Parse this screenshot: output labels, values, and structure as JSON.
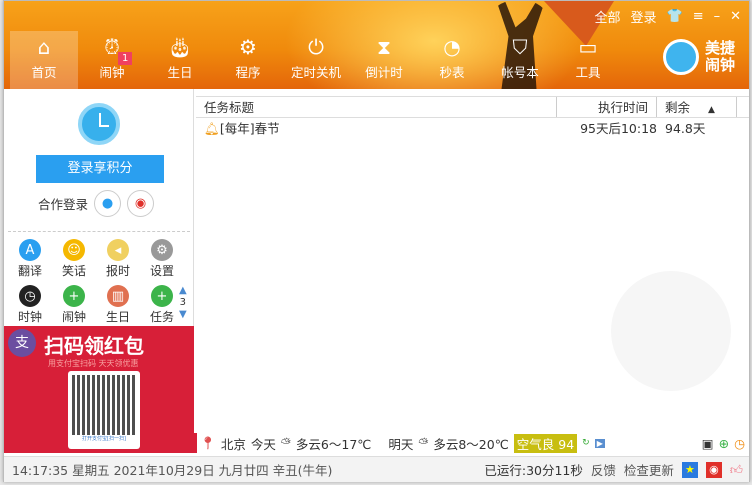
{
  "header": {
    "top_links": [
      "全部",
      "登录"
    ],
    "nav": [
      {
        "label": "首页",
        "icon": "home-icon"
      },
      {
        "label": "闹钟",
        "icon": "alarm-icon",
        "badge": "1"
      },
      {
        "label": "生日",
        "icon": "cake-icon"
      },
      {
        "label": "程序",
        "icon": "gear-icon"
      },
      {
        "label": "定时关机",
        "icon": "power-icon"
      },
      {
        "label": "倒计时",
        "icon": "hourglass-icon"
      },
      {
        "label": "秒表",
        "icon": "stopwatch-icon"
      },
      {
        "label": "帐号本",
        "icon": "shield-icon"
      },
      {
        "label": "工具",
        "icon": "monitor-icon"
      }
    ],
    "brand": "美捷闹钟"
  },
  "left": {
    "login_button": "登录享积分",
    "coop_login": "合作登录",
    "tools": [
      {
        "label": "翻译",
        "color": "#2a9ff0",
        "glyph": "A"
      },
      {
        "label": "笑话",
        "color": "#f5b800",
        "glyph": "☺"
      },
      {
        "label": "报时",
        "color": "#f0d060",
        "glyph": "◂"
      },
      {
        "label": "设置",
        "color": "#999999",
        "glyph": "⚙"
      },
      {
        "label": "时钟",
        "color": "#222222",
        "glyph": "◷"
      },
      {
        "label": "闹钟",
        "color": "#3cb44a",
        "glyph": "+"
      },
      {
        "label": "生日",
        "color": "#e07050",
        "glyph": "▥"
      },
      {
        "label": "任务",
        "color": "#3cb44a",
        "glyph": "+"
      }
    ],
    "page": "3",
    "ad": {
      "title": "扫码领红包",
      "subtitle": "用支付宝扫码  天天领优惠",
      "qr_caption": "打开支付宝[扫一扫]",
      "logo": "支"
    }
  },
  "list": {
    "columns": [
      "任务标题",
      "执行时间",
      "剩余"
    ],
    "rows": [
      {
        "title": "[每年]春节",
        "time": "95天后10:18",
        "remaining": "94.8天"
      }
    ]
  },
  "weather": {
    "city": "北京",
    "today_label": "今天",
    "today": "多云6～17℃",
    "tomorrow_label": "明天",
    "tomorrow": "多云8～20℃",
    "air": "空气良 94"
  },
  "status": {
    "datetime": "14:17:35 星期五 2021年10月29日 九月廿四 辛丑(牛年)",
    "runtime": "已运行:30分11秒",
    "feedback": "反馈",
    "update": "检查更新"
  },
  "colors": {
    "accent": "#2a9ff0",
    "header": "#f08a0c",
    "ad": "#d71f38"
  }
}
